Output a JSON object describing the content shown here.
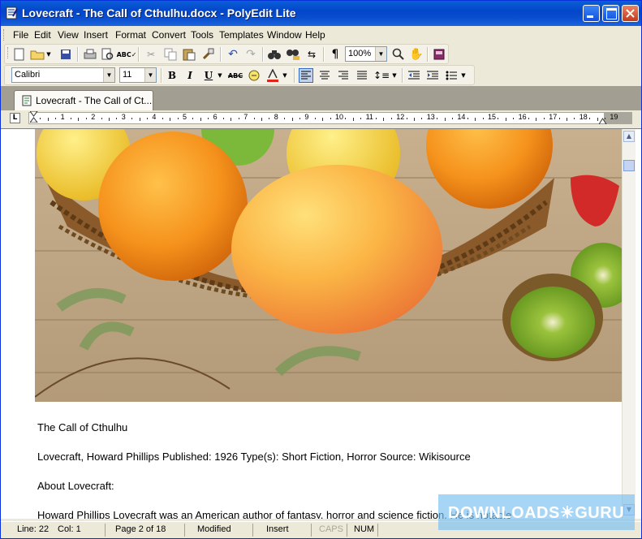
{
  "window": {
    "title": "Lovecraft - The Call of Cthulhu.docx - PolyEdit Lite"
  },
  "menu": [
    "File",
    "Edit",
    "View",
    "Insert",
    "Format",
    "Convert",
    "Tools",
    "Templates",
    "Window",
    "Help"
  ],
  "format_bar": {
    "font_name": "Calibri",
    "font_size": "11"
  },
  "toolbar": {
    "zoom": "100%"
  },
  "tab": {
    "label": "Lovecraft - The Call of Ct..."
  },
  "ruler": {
    "numbers": [
      "1",
      "2",
      "3",
      "4",
      "5",
      "6",
      "7",
      "8",
      "9",
      "10",
      "11",
      "12",
      "13",
      "14",
      "15",
      "16",
      "17",
      "18",
      "19"
    ]
  },
  "document": {
    "heading": "The Call of Cthulhu",
    "meta": "Lovecraft, Howard Phillips Published: 1926 Type(s): Short Fiction, Horror Source: Wikisource",
    "about": "About Lovecraft:",
    "body_partial": "Howard Phillips Lovecraft was an American author of fantasy, horror and science fiction. He is notable"
  },
  "status": {
    "line": "Line:  22",
    "col": "Col:  1",
    "page": "Page 2 of 18",
    "modified": "Modified",
    "insert": "Insert",
    "caps": "CAPS",
    "num": "NUM"
  },
  "watermark": {
    "text": "DOWNLOADS☀GURU"
  },
  "colors": {
    "title_blue": "#0a5fd8",
    "status_bg": "#ece9d8"
  }
}
